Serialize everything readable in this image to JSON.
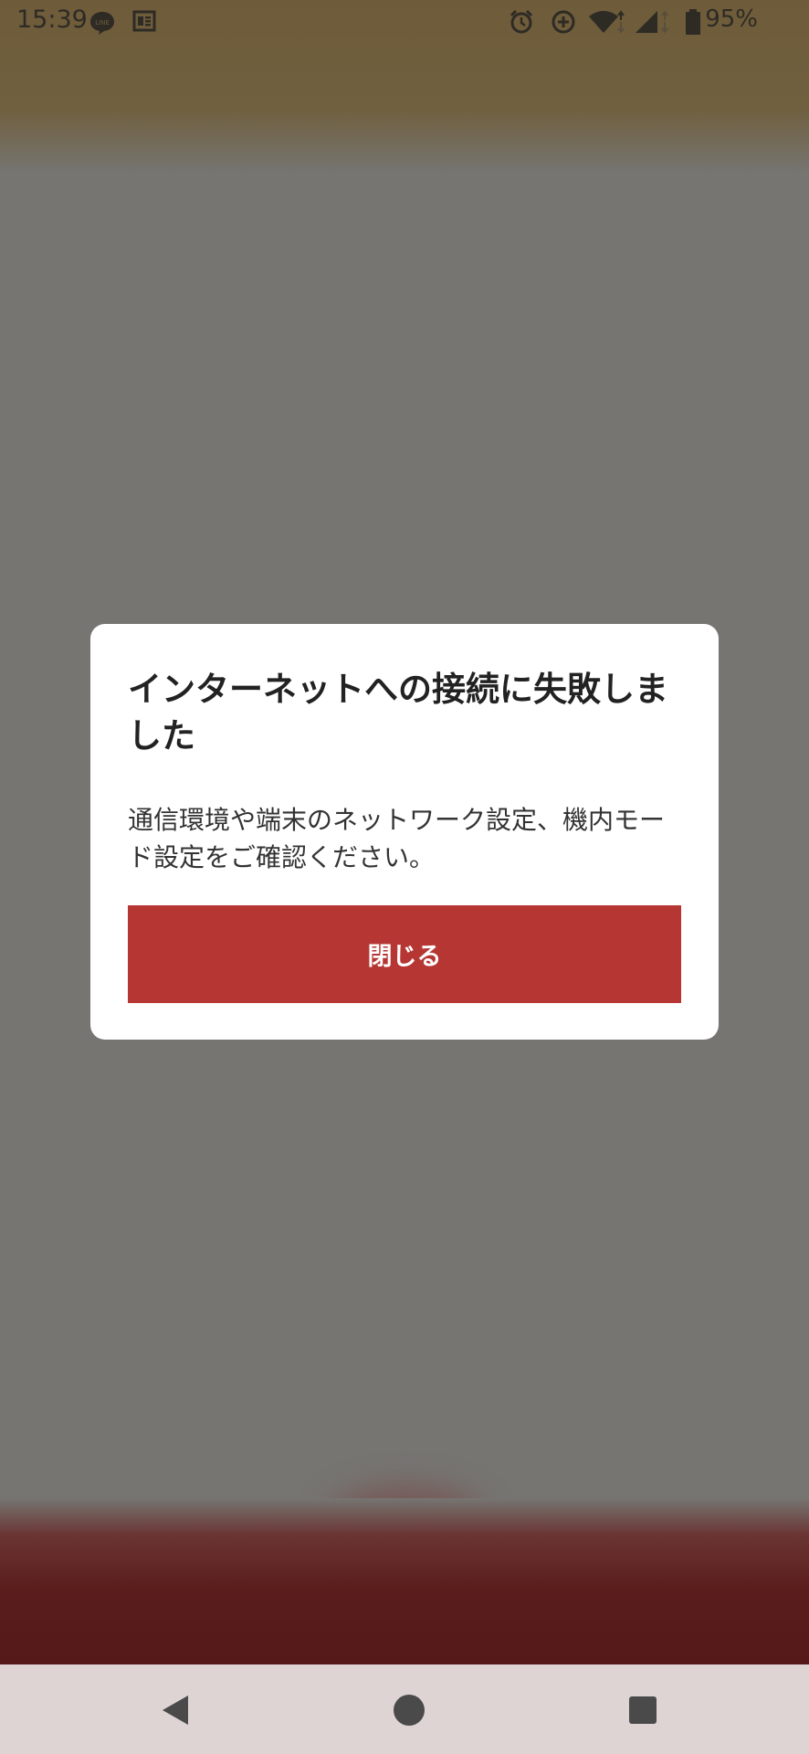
{
  "status_bar": {
    "time": "15:39",
    "battery": "95%",
    "icons": [
      "line-app-icon",
      "news-icon",
      "alarm-icon",
      "data-saver-icon",
      "wifi-icon",
      "cell-signal-icon",
      "battery-icon"
    ]
  },
  "dialog": {
    "title": "インターネットへの接続に失敗しました",
    "message": "通信環境や端末のネットワーク設定、機内モード設定をご確認ください。",
    "close_label": "閉じる"
  },
  "nav_bar": {
    "icons": [
      "back-icon",
      "home-icon",
      "recents-icon"
    ]
  },
  "colors": {
    "accent": "#b53632",
    "overlay": "#767572",
    "nav_bar": "#dfd4d4"
  }
}
